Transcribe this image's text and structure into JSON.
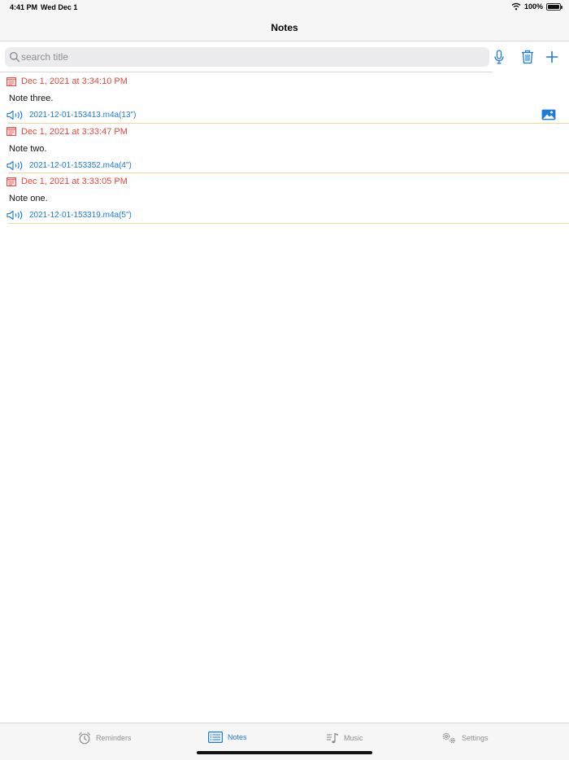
{
  "status_bar": {
    "time": "4:41 PM",
    "date": "Wed Dec 1",
    "battery": "100%",
    "battery_level": 1.0,
    "icons": [
      "wifi-icon",
      "battery-icon"
    ]
  },
  "nav": {
    "title": "Notes"
  },
  "search": {
    "placeholder": "search title",
    "value": ""
  },
  "toolbar": {
    "icons": [
      "mic-icon",
      "trash-icon",
      "plus-icon"
    ]
  },
  "notes": [
    {
      "date": "Dec 1, 2021 at 3:34:10 PM",
      "title": "Note three.",
      "audio": "2021-12-01-153413.m4a(13\")",
      "has_image": true
    },
    {
      "date": "Dec 1, 2021 at 3:33:47 PM",
      "title": "Note two.",
      "audio": "2021-12-01-153352.m4a(4\")",
      "has_image": false
    },
    {
      "date": "Dec 1, 2021 at 3:33:05 PM",
      "title": "Note one.",
      "audio": "2021-12-01-153319.m4a(5\")",
      "has_image": false
    }
  ],
  "tabs": [
    {
      "label": "Reminders",
      "icon": "alarm-clock-icon",
      "active": false
    },
    {
      "label": "Notes",
      "icon": "notes-list-icon",
      "active": true
    },
    {
      "label": "Music",
      "icon": "music-note-icon",
      "active": false
    },
    {
      "label": "Settings",
      "icon": "gears-icon",
      "active": false
    }
  ],
  "colors": {
    "accent": "#1a7ae0",
    "date_red": "#e8453c",
    "divider_gold": "#f0d79a",
    "tab_inactive": "#8e8e93"
  }
}
